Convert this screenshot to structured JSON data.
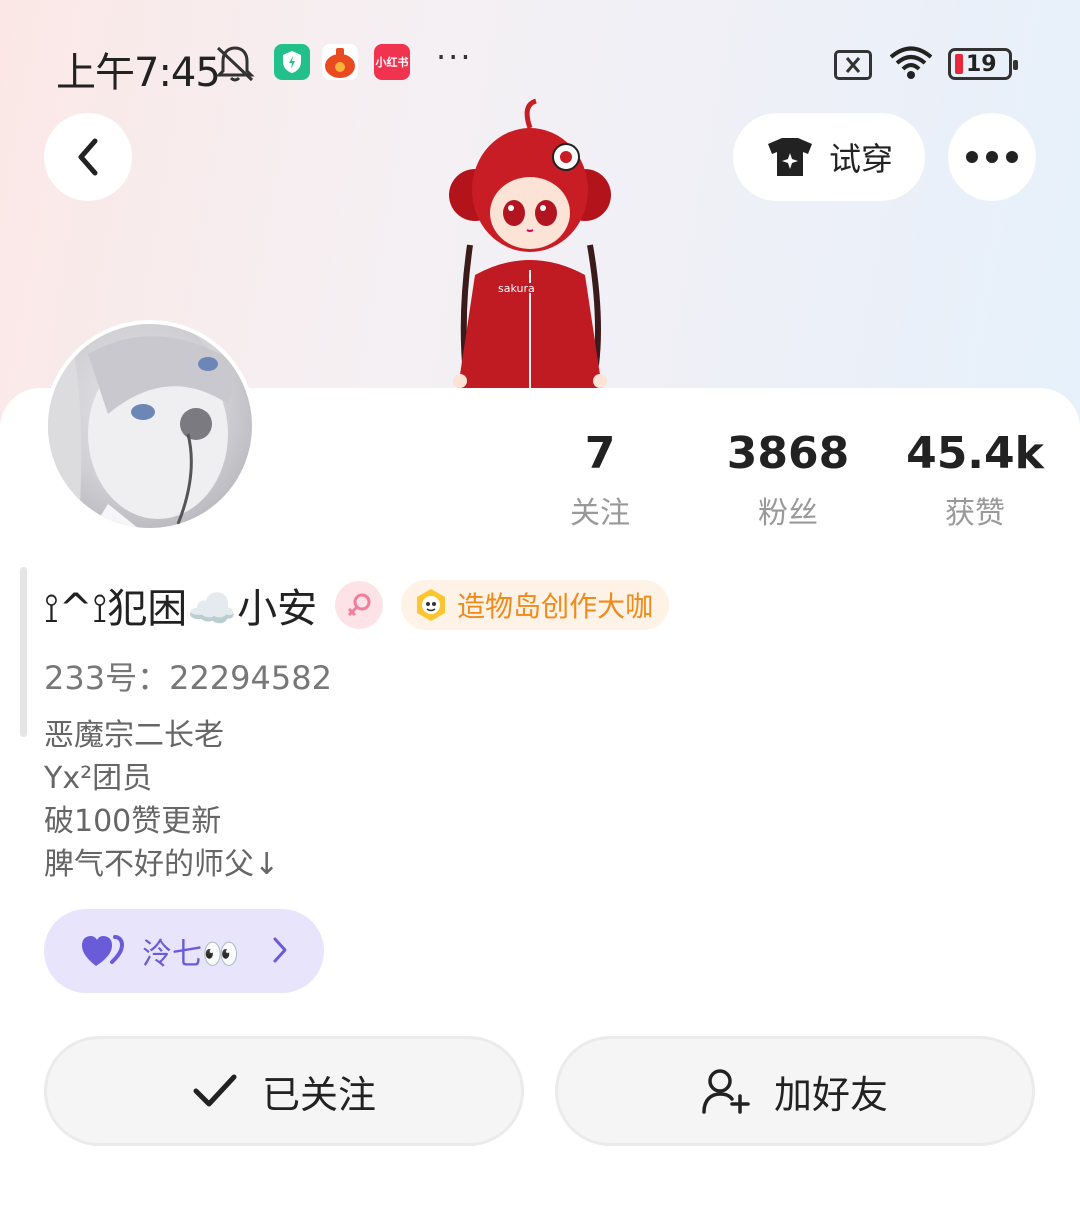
{
  "status_bar": {
    "time": "上午7:45",
    "notification_app_label": "小红书",
    "more_indicator": "···",
    "battery_level": "19"
  },
  "header": {
    "try_on_label": "试穿"
  },
  "profile": {
    "stats": [
      {
        "value": "7",
        "label": "关注"
      },
      {
        "value": "3868",
        "label": "粉丝"
      },
      {
        "value": "45.4k",
        "label": "获赞"
      }
    ],
    "name": "⟟^⟟犯困☁️小安",
    "title_badge": "造物岛创作大咖",
    "uid": "233号：22294582",
    "bio": [
      "恶魔宗二长老",
      "Yx²团员",
      "破100赞更新",
      "脾气不好的师父↓"
    ],
    "friend_tag": "泠七👀"
  },
  "actions": {
    "follow_label": "已关注",
    "add_friend_label": "加好友"
  },
  "colors": {
    "accent_purple": "#6a5bd8",
    "badge_orange": "#f08a1a",
    "gender_pink": "#f27d9c"
  }
}
